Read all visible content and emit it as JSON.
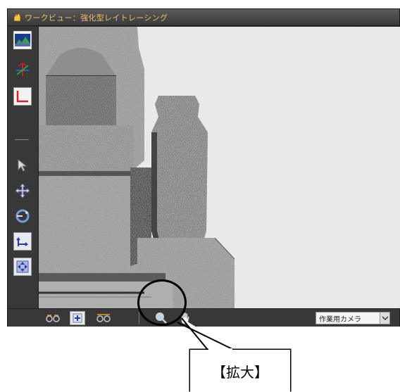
{
  "window": {
    "title": "ワークビュー：強化型レイトレーシング",
    "app_icon": "app-hand-icon"
  },
  "left_toolbar": {
    "tools": [
      {
        "name": "texture-view-icon"
      },
      {
        "name": "axis-icon"
      },
      {
        "name": "corner-frame-icon"
      },
      {
        "name": "select-arrow-icon"
      },
      {
        "name": "move-icon"
      },
      {
        "name": "rotate-icon"
      },
      {
        "name": "pan-corner-icon"
      },
      {
        "name": "fit-view-icon"
      }
    ]
  },
  "bottom_toolbar": {
    "buttons": [
      {
        "name": "walk-left-icon"
      },
      {
        "name": "plus-icon"
      },
      {
        "name": "walk-right-icon"
      },
      {
        "name": "zoom-magnifier-icon"
      },
      {
        "name": "hand-pan-icon"
      }
    ],
    "camera_select": {
      "value": "作業用カメラ"
    }
  },
  "callout": {
    "label": "【拡大】"
  },
  "colors": {
    "title_text": "#f0c060",
    "panel_bg": "#383838",
    "viewport_bg": "#e9e9ea"
  }
}
